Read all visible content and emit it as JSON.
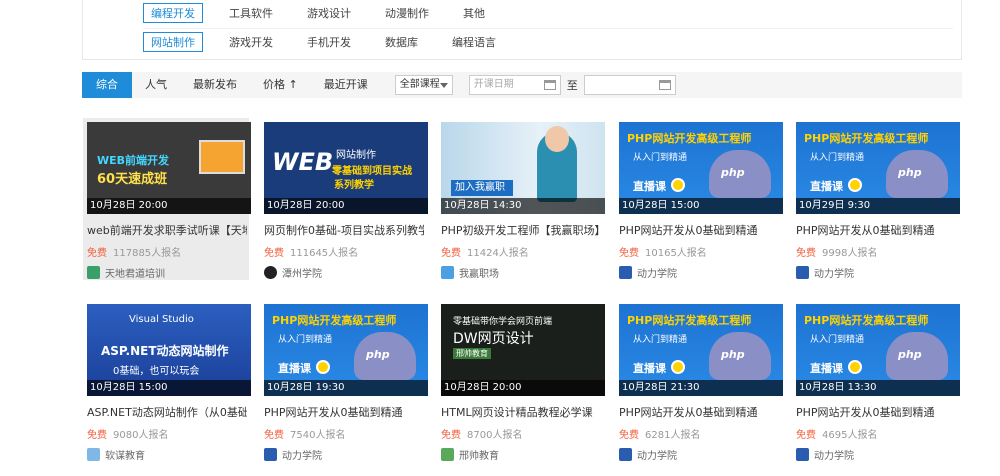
{
  "categories": {
    "row1": [
      "编程开发",
      "工具软件",
      "游戏设计",
      "动漫制作",
      "其他"
    ],
    "row2": [
      "网站制作",
      "游戏开发",
      "手机开发",
      "数据库",
      "编程语言"
    ]
  },
  "sortbar": {
    "items": [
      "综合",
      "人气",
      "最新发布",
      "价格 ↑",
      "最近开课"
    ],
    "select_value": "全部课程",
    "date_start_placeholder": "开课日期",
    "to_label": "至",
    "date_end_placeholder": ""
  },
  "courses": [
    {
      "date": "10月28日 20:00",
      "title": "web前端开发求职季试听课【天地…",
      "price": "免费",
      "count": "117885人报名",
      "org": "天地君道培训",
      "thumb_text": [
        "WEB前端开发",
        "60天速成班"
      ],
      "logo_color": "#3aa06a"
    },
    {
      "date": "10月28日 20:00",
      "title": "网页制作0基础-项目实战系列教学…",
      "price": "免费",
      "count": "111645人报名",
      "org": "潭州学院",
      "thumb_text": [
        "WEB",
        "网站制作",
        "零基础到项目实战",
        "系列教学"
      ],
      "logo_color": "#222222"
    },
    {
      "date": "10月28日 14:30",
      "title": "PHP初级开发工程师【我赢职场】",
      "price": "免费",
      "count": "11424人报名",
      "org": "我赢职场",
      "thumb_text": [
        "加入我赢职场"
      ],
      "logo_color": "#4aa0e0"
    },
    {
      "date": "10月28日 15:00",
      "title": "PHP网站开发从0基础到精通",
      "price": "免费",
      "count": "10165人报名",
      "org": "动力学院",
      "thumb_text": [
        "PHP网站开发高级工程师",
        "从入门到精通",
        "直播课",
        "php"
      ],
      "logo_color": "#2a5cb0"
    },
    {
      "date": "10月29日 9:30",
      "title": "PHP网站开发从0基础到精通",
      "price": "免费",
      "count": "9998人报名",
      "org": "动力学院",
      "thumb_text": [
        "PHP网站开发高级工程师",
        "从入门到精通",
        "直播课",
        "php"
      ],
      "logo_color": "#2a5cb0"
    },
    {
      "date": "10月28日 15:00",
      "title": "ASP.NET动态网站制作（从0基础…",
      "price": "免费",
      "count": "9080人报名",
      "org": "软谋教育",
      "thumb_text": [
        "Visual Studio",
        "ASP.NET动态网站制作",
        "0基础，也可以玩会"
      ],
      "logo_color": "#7fb8e6"
    },
    {
      "date": "10月28日 19:30",
      "title": "PHP网站开发从0基础到精通",
      "price": "免费",
      "count": "7540人报名",
      "org": "动力学院",
      "thumb_text": [
        "PHP网站开发高级工程师",
        "从入门到精通",
        "直播课",
        "php"
      ],
      "logo_color": "#2a5cb0"
    },
    {
      "date": "10月28日 20:00",
      "title": "HTML网页设计精品教程必学课",
      "price": "免费",
      "count": "8700人报名",
      "org": "邢帅教育",
      "thumb_text": [
        "零基础带你学会网页前端",
        "DW网页设计",
        "邢帅教育"
      ],
      "logo_color": "#5aa85a"
    },
    {
      "date": "10月28日 21:30",
      "title": "PHP网站开发从0基础到精通",
      "price": "免费",
      "count": "6281人报名",
      "org": "动力学院",
      "thumb_text": [
        "PHP网站开发高级工程师",
        "从入门到精通",
        "直播课",
        "php"
      ],
      "logo_color": "#2a5cb0"
    },
    {
      "date": "10月28日 13:30",
      "title": "PHP网站开发从0基础到精通",
      "price": "免费",
      "count": "4695人报名",
      "org": "动力学院",
      "thumb_text": [
        "PHP网站开发高级工程师",
        "从入门到精通",
        "直播课",
        "php"
      ],
      "logo_color": "#2a5cb0"
    }
  ]
}
